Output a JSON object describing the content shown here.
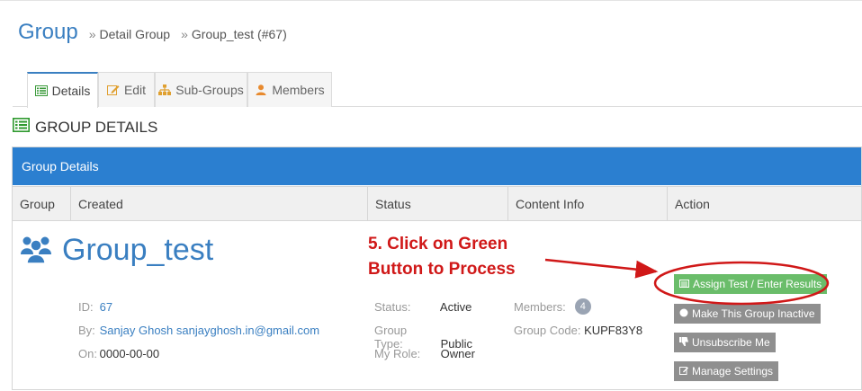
{
  "breadcrumb": {
    "title": "Group",
    "separator": "»",
    "items": [
      "Detail Group",
      "Group_test (#67)"
    ]
  },
  "tabs": [
    {
      "label": "Details",
      "icon": "list-icon",
      "active": true
    },
    {
      "label": "Edit",
      "icon": "edit-icon",
      "active": false
    },
    {
      "label": "Sub-Groups",
      "icon": "sitemap-icon",
      "active": false
    },
    {
      "label": "Members",
      "icon": "user-icon",
      "active": false
    }
  ],
  "section_title": "GROUP DETAILS",
  "panel": {
    "heading": "Group Details",
    "columns": [
      "Group",
      "Created",
      "Status",
      "Content Info",
      "Action"
    ]
  },
  "group": {
    "name": "Group_test",
    "id_label": "ID:",
    "id": "67",
    "by_label": "By:",
    "by": "Sanjay Ghosh sanjayghosh.in@gmail.com",
    "on_label": "On:",
    "on": "0000-00-00"
  },
  "status": {
    "status_label": "Status:",
    "status": "Active",
    "type_label": "Group Type:",
    "type": "Public",
    "role_label": "My Role:",
    "role": "Owner"
  },
  "content_info": {
    "members_label": "Members:",
    "members": "4",
    "code_label": "Group Code:",
    "code": "KUPF83Y8"
  },
  "actions": {
    "assign": "Assign Test / Enter Results",
    "inactive": "Make This Group Inactive",
    "unsubscribe": "Unsubscribe Me",
    "manage": "Manage Settings"
  },
  "annotation": {
    "line1": "5. Click on Green",
    "line2": "Button to Process"
  },
  "colors": {
    "accent": "#3a7fc1",
    "panel_header": "#2b7fd0",
    "success": "#6abd6a",
    "secondary": "#8f8f8f",
    "annotation": "#d01818"
  }
}
